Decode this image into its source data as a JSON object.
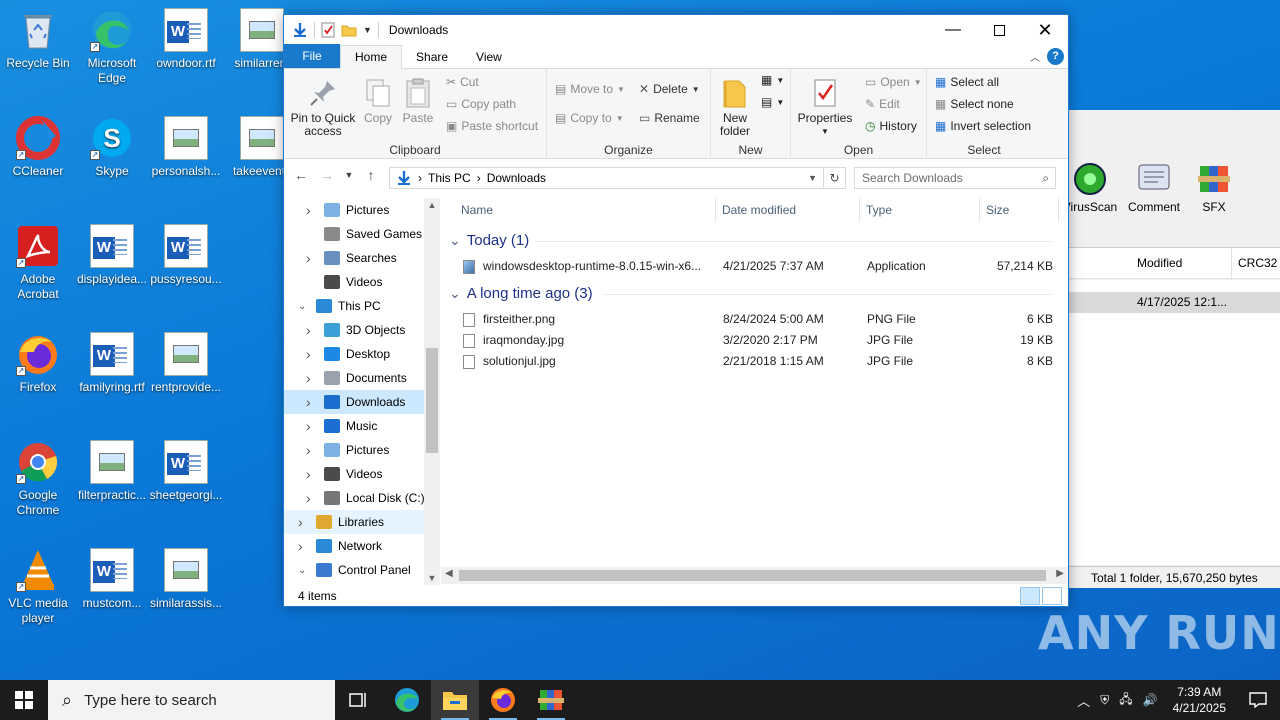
{
  "desktop": {
    "icons": [
      {
        "label": "Recycle Bin",
        "icon": "recycle-bin-icon"
      },
      {
        "label": "Microsoft Edge",
        "icon": "edge-icon"
      },
      {
        "label": "owndoor.rtf",
        "icon": "word-doc-icon"
      },
      {
        "label": "similarrent",
        "icon": "image-file-icon"
      },
      {
        "label": "CCleaner",
        "icon": "ccleaner-icon"
      },
      {
        "label": "Skype",
        "icon": "skype-icon"
      },
      {
        "label": "personalsh...",
        "icon": "image-file-icon"
      },
      {
        "label": "takeevents",
        "icon": "image-file-icon"
      },
      {
        "label": "Adobe Acrobat",
        "icon": "acrobat-icon"
      },
      {
        "label": "displayidea...",
        "icon": "word-doc-icon"
      },
      {
        "label": "pussyresou...",
        "icon": "word-doc-icon"
      },
      {
        "label": "Firefox",
        "icon": "firefox-icon"
      },
      {
        "label": "familyring.rtf",
        "icon": "word-doc-icon"
      },
      {
        "label": "rentprovide...",
        "icon": "image-file-icon"
      },
      {
        "label": "Google Chrome",
        "icon": "chrome-icon"
      },
      {
        "label": "filterpractic...",
        "icon": "image-file-icon"
      },
      {
        "label": "sheetgeorgi...",
        "icon": "word-doc-icon"
      },
      {
        "label": "VLC media player",
        "icon": "vlc-icon"
      },
      {
        "label": "mustcom...",
        "icon": "word-doc-icon"
      },
      {
        "label": "similarassis...",
        "icon": "image-file-icon"
      }
    ]
  },
  "explorer": {
    "title": "Downloads",
    "tabs": [
      "File",
      "Home",
      "Share",
      "View"
    ],
    "ribbon": {
      "clipboard": {
        "label": "Clipboard",
        "pin": "Pin to Quick access",
        "copy": "Copy",
        "paste": "Paste",
        "cut": "Cut",
        "copy_path": "Copy path",
        "paste_shortcut": "Paste shortcut"
      },
      "organize": {
        "label": "Organize",
        "move_to": "Move to",
        "copy_to": "Copy to",
        "delete": "Delete",
        "rename": "Rename"
      },
      "new": {
        "label": "New",
        "new_folder": "New folder"
      },
      "open": {
        "label": "Open",
        "properties": "Properties",
        "open": "Open",
        "edit": "Edit",
        "history": "History"
      },
      "select": {
        "label": "Select",
        "select_all": "Select all",
        "select_none": "Select none",
        "invert": "Invert selection"
      }
    },
    "address": {
      "crumbs": [
        "This PC",
        "Downloads"
      ],
      "search_placeholder": "Search Downloads"
    },
    "nav": [
      {
        "label": "Pictures",
        "icon": "pictures-folder-icon",
        "level": 1,
        "chevron": "right"
      },
      {
        "label": "Saved Games",
        "icon": "saved-games-icon",
        "level": 1,
        "chevron": ""
      },
      {
        "label": "Searches",
        "icon": "search-folder-icon",
        "level": 1,
        "chevron": "right"
      },
      {
        "label": "Videos",
        "icon": "videos-folder-icon",
        "level": 1,
        "chevron": ""
      },
      {
        "label": "This PC",
        "icon": "this-pc-icon",
        "level": 0,
        "chevron": "down"
      },
      {
        "label": "3D Objects",
        "icon": "3d-objects-icon",
        "level": 1,
        "chevron": "right"
      },
      {
        "label": "Desktop",
        "icon": "desktop-folder-icon",
        "level": 1,
        "chevron": "right"
      },
      {
        "label": "Documents",
        "icon": "documents-folder-icon",
        "level": 1,
        "chevron": "right"
      },
      {
        "label": "Downloads",
        "icon": "downloads-folder-icon",
        "level": 1,
        "chevron": "right",
        "selected": true
      },
      {
        "label": "Music",
        "icon": "music-folder-icon",
        "level": 1,
        "chevron": "right"
      },
      {
        "label": "Pictures",
        "icon": "pictures-folder-icon",
        "level": 1,
        "chevron": "right"
      },
      {
        "label": "Videos",
        "icon": "videos-folder-icon",
        "level": 1,
        "chevron": "right"
      },
      {
        "label": "Local Disk (C:)",
        "icon": "local-disk-icon",
        "level": 1,
        "chevron": "right"
      },
      {
        "label": "Libraries",
        "icon": "libraries-icon",
        "level": 0,
        "chevron": "right",
        "hover": true
      },
      {
        "label": "Network",
        "icon": "network-icon",
        "level": 0,
        "chevron": "right"
      },
      {
        "label": "Control Panel",
        "icon": "control-panel-icon",
        "level": 0,
        "chevron": "down"
      }
    ],
    "columns": [
      "Name",
      "Date modified",
      "Type",
      "Size"
    ],
    "groups": [
      {
        "title": "Today (1)",
        "files": [
          {
            "name": "windowsdesktop-runtime-8.0.15-win-x6...",
            "date": "4/21/2025 7:37 AM",
            "type": "Application",
            "size": "57,214 KB",
            "icon": "installer-icon"
          }
        ]
      },
      {
        "title": "A long time ago (3)",
        "files": [
          {
            "name": "firsteither.png",
            "date": "8/24/2024 5:00 AM",
            "type": "PNG File",
            "size": "6 KB",
            "icon": "png-file-icon"
          },
          {
            "name": "iraqmonday.jpg",
            "date": "3/2/2020 2:17 PM",
            "type": "JPG File",
            "size": "19 KB",
            "icon": "jpg-file-icon"
          },
          {
            "name": "solutionjul.jpg",
            "date": "2/21/2018 1:15 AM",
            "type": "JPG File",
            "size": "8 KB",
            "icon": "jpg-file-icon"
          }
        ]
      }
    ],
    "status": "4 items"
  },
  "winrar": {
    "toolbar": [
      "VirusScan",
      "Comment",
      "SFX"
    ],
    "columns": [
      "Modified",
      "CRC32"
    ],
    "row_modified": "4/17/2025 12:1...",
    "status": "Total 1 folder, 15,670,250 bytes"
  },
  "watermark": "ANY RUN",
  "taskbar": {
    "search_placeholder": "Type here to search",
    "time": "7:39 AM",
    "date": "4/21/2025"
  },
  "colors": {
    "accent": "#1979ca",
    "selection": "#cce8ff",
    "desktop": "#0a78d7"
  }
}
